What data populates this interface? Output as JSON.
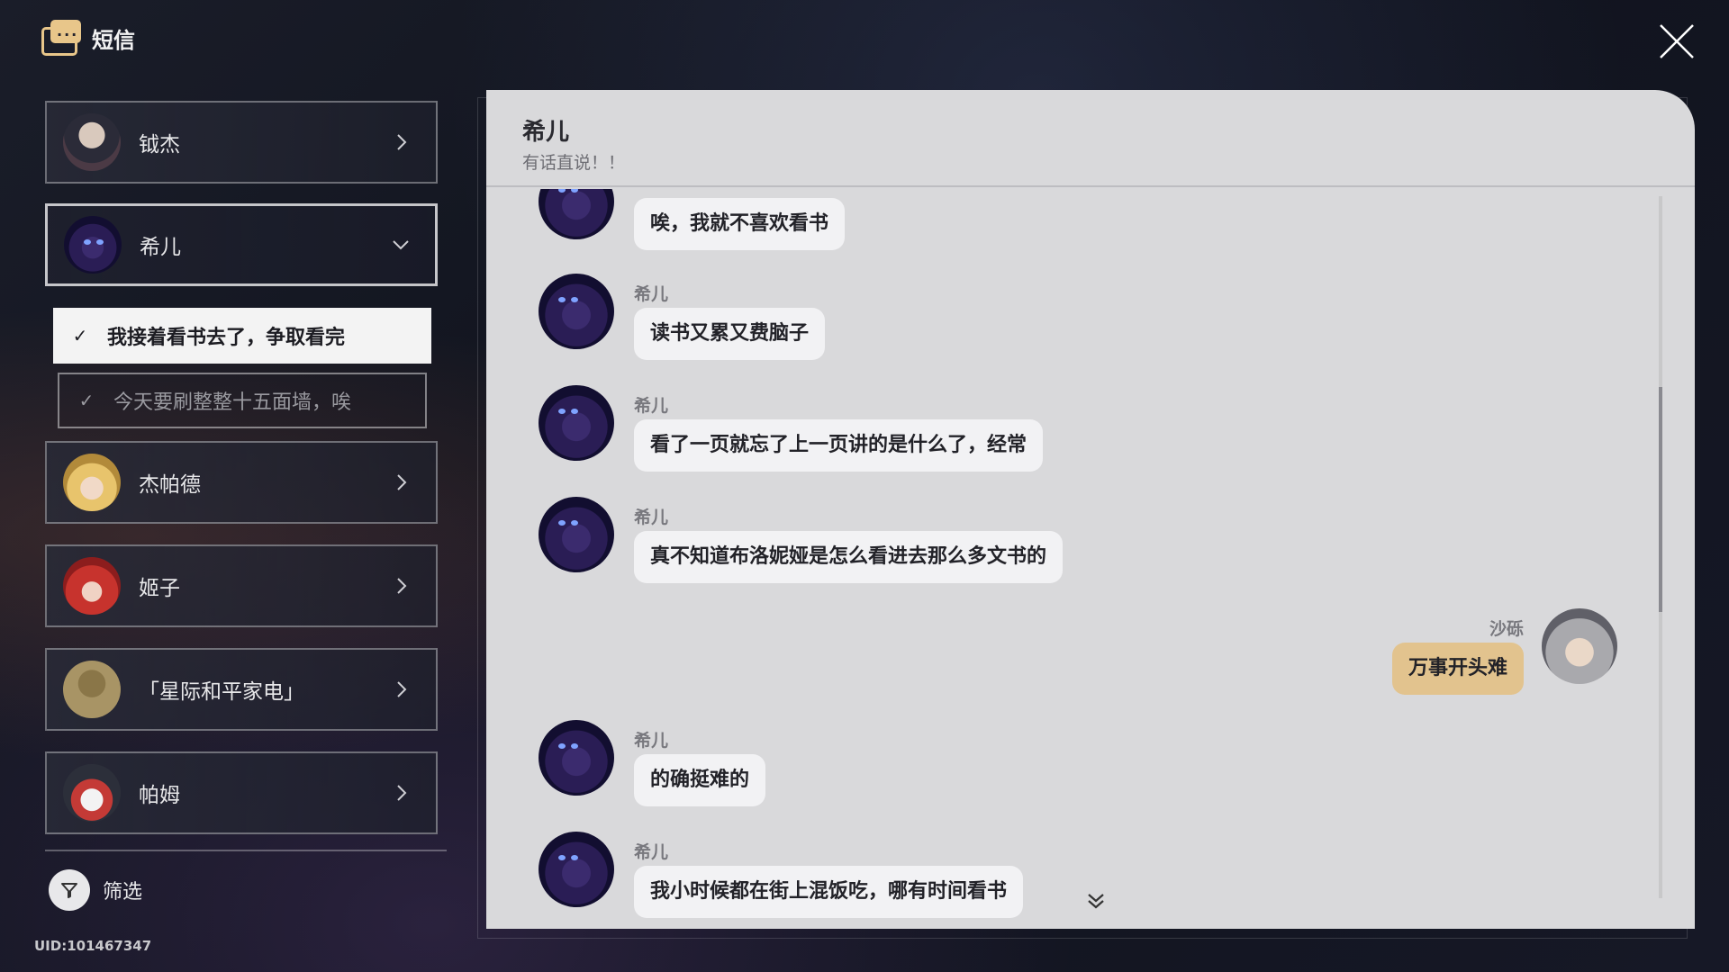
{
  "app": {
    "title": "短信"
  },
  "contacts": [
    {
      "name": "钺杰",
      "avatar": "jiejie"
    },
    {
      "name": "希儿",
      "avatar": "seele"
    },
    {
      "name": "杰帕德",
      "avatar": "gepard"
    },
    {
      "name": "姬子",
      "avatar": "himeko"
    },
    {
      "name": "「星际和平家电」",
      "avatar": "unknown"
    },
    {
      "name": "帕姆",
      "avatar": "pom"
    }
  ],
  "tasks": [
    {
      "text": "我接着看书去了，争取看完",
      "selected": true
    },
    {
      "text": "今天要刷整整十五面墙，唉",
      "selected": false
    }
  ],
  "filter": {
    "label": "筛选"
  },
  "uid": "UID:101467347",
  "chat": {
    "name": "希儿",
    "status": "有话直说！！",
    "messages": [
      {
        "sender": "",
        "text": "唉，我就不喜欢看书",
        "side": "left"
      },
      {
        "sender": "希儿",
        "text": "读书又累又费脑子",
        "side": "left"
      },
      {
        "sender": "希儿",
        "text": "看了一页就忘了上一页讲的是什么了，经常",
        "side": "left"
      },
      {
        "sender": "希儿",
        "text": "真不知道布洛妮娅是怎么看进去那么多文书的",
        "side": "left"
      },
      {
        "sender": "沙砾",
        "text": "万事开头难",
        "side": "right"
      },
      {
        "sender": "希儿",
        "text": "的确挺难的",
        "side": "left"
      },
      {
        "sender": "希儿",
        "text": "我小时候都在街上混饭吃，哪有时间看书",
        "side": "left"
      }
    ]
  },
  "colors": {
    "bubble_self": "#e2c38e",
    "bubble_other": "#f2f2f4",
    "accent": "#e8c68a"
  }
}
